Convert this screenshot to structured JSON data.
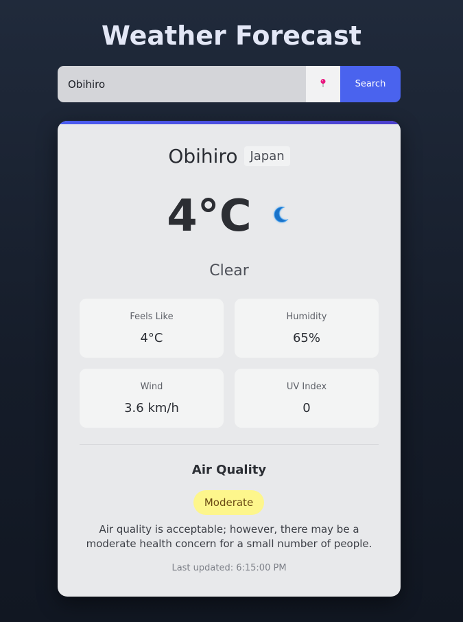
{
  "app": {
    "title": "Weather Forecast"
  },
  "search": {
    "value": "Obihiro",
    "location_icon": "pin-icon",
    "button_label": "Search",
    "accent_color": "#4a63ee"
  },
  "location": {
    "city": "Obihiro",
    "country": "Japan"
  },
  "current": {
    "temperature": "4°C",
    "condition": "Clear",
    "condition_icon": "moon-icon"
  },
  "stats": [
    {
      "label": "Feels Like",
      "value": "4°C"
    },
    {
      "label": "Humidity",
      "value": "65%"
    },
    {
      "label": "Wind",
      "value": "3.6 km/h"
    },
    {
      "label": "UV Index",
      "value": "0"
    }
  ],
  "air_quality": {
    "title": "Air Quality",
    "level": "Moderate",
    "level_color": "#fdf68c",
    "description": "Air quality is acceptable; however, there may be a moderate health concern for a small number of people."
  },
  "last_updated": "Last updated: 6:15:00 PM"
}
